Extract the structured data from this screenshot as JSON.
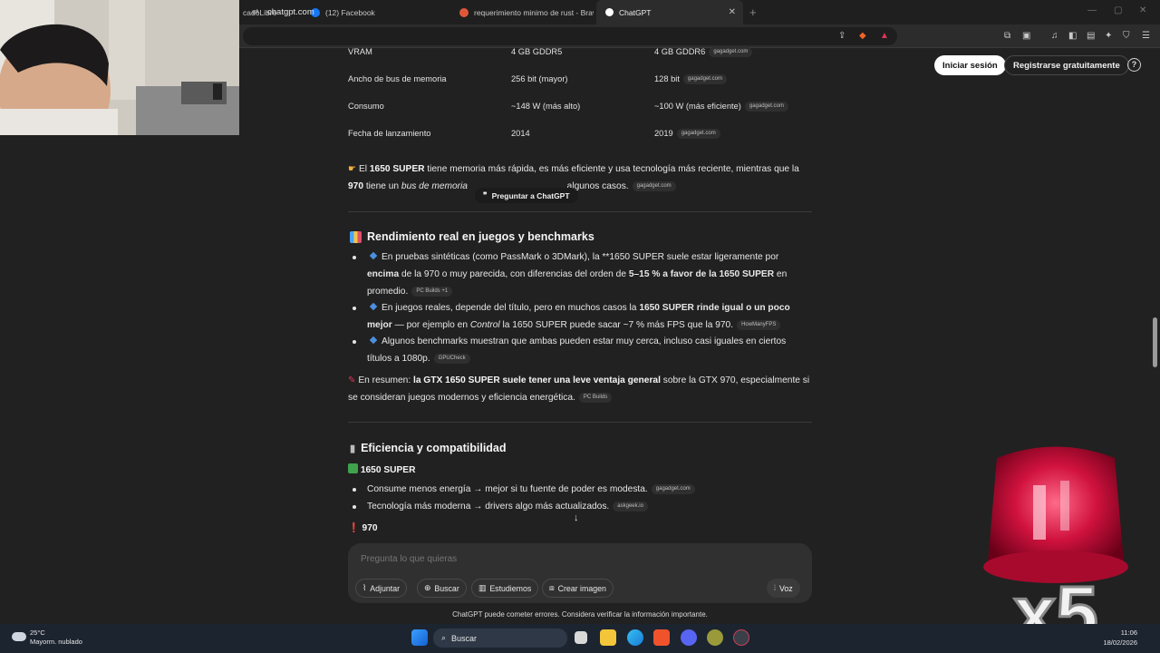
{
  "browser": {
    "tabs": [
      {
        "label": "cadoLibre",
        "active": false
      },
      {
        "label": "(12) Facebook",
        "active": false
      },
      {
        "label": "requerimiento minimo de rust - Brave",
        "active": false
      },
      {
        "label": "ChatGPT",
        "active": true
      }
    ],
    "url": "chatgpt.com"
  },
  "header": {
    "login_label": "Iniciar sesión",
    "register_label": "Registrarse gratuitamente",
    "help_label": "?"
  },
  "table": {
    "rows": [
      {
        "spec": "VRAM",
        "gtx970": "4 GB GDDR5",
        "gtx1650": "4 GB GDDR6",
        "source": "gagadget.com"
      },
      {
        "spec": "Ancho de bus de memoria",
        "gtx970": "256 bit (mayor)",
        "gtx1650": "128 bit",
        "source": "gagadget.com"
      },
      {
        "spec": "Consumo",
        "gtx970": "~148 W (más alto)",
        "gtx1650": "~100 W (más eficiente)",
        "source": "gagadget.com"
      },
      {
        "spec": "Fecha de lanzamiento",
        "gtx970": "2014",
        "gtx1650": "2019",
        "source": "gagadget.com"
      }
    ]
  },
  "summary": {
    "p1_prefix": "El ",
    "p1_bold": "1650 SUPER",
    "p1_rest": " tiene memoria más rápida, es más eficiente y usa tecnología más reciente, mientras que la",
    "p2_bold": "970",
    "p2_mid": " tiene un ",
    "p2_italic": "bus de memoria",
    "p2_end": "algunos casos.",
    "source": "gagadget.com",
    "ask_label": "Preguntar a ChatGPT"
  },
  "section_perf": {
    "title": "Rendimiento real en juegos y benchmarks",
    "items": [
      {
        "line1": "En pruebas sintéticas (como PassMark o 3DMark), la **1650 SUPER suele estar ligeramente por",
        "line2_bold": "encima",
        "line2_mid": " de la 970 o muy parecida, con diferencias del orden de ",
        "line2_bold2": "5–15 % a favor de la 1650 SUPER",
        "line2_end": " en",
        "line3": "promedio.",
        "source": "PC Builds +1"
      },
      {
        "line1_pre": "En juegos reales, depende del título, pero en muchos casos la ",
        "line1_bold": "1650 SUPER rinde igual o un poco",
        "line2_bold": "mejor",
        "line2_mid": " — por ejemplo en ",
        "line2_italic": "Control",
        "line2_end": " la 1650 SUPER puede sacar ~7 % más FPS que la 970.",
        "source": "HowManyFPS"
      },
      {
        "line1": "Algunos benchmarks muestran que ambas pueden estar muy cerca, incluso casi iguales en ciertos",
        "line2": "títulos a 1080p.",
        "source": "GPUCheck"
      }
    ],
    "conclusion_pre": "En resumen: ",
    "conclusion_bold": "la GTX 1650 SUPER suele tener una leve ventaja general",
    "conclusion_rest": " sobre la GTX 970, especialmente si",
    "conclusion_line2": "se consideran juegos modernos y eficiencia energética.",
    "conclusion_source": "PC Builds"
  },
  "section_eff": {
    "title": "Eficiencia y compatibilidad",
    "card1_title": "1650 SUPER",
    "items": [
      {
        "text": "Consume menos energía → mejor si tu fuente de poder es modesta.",
        "source": "gagadget.com"
      },
      {
        "text": "Tecnología más moderna → drivers algo más actualizados.",
        "source": "askgeek.io"
      }
    ],
    "card2_title": "970"
  },
  "composer": {
    "placeholder": "Pregunta lo que quieras",
    "buttons": {
      "attach": "Adjuntar",
      "search": "Buscar",
      "study": "Estudiemos",
      "image": "Crear imagen"
    },
    "voice_label": "Voz"
  },
  "disclaimer": "ChatGPT puede cometer errores. Considera verificar la información importante.",
  "overlay": {
    "multiplier": "x5"
  },
  "taskbar": {
    "temperature": "25°C",
    "weather": "Mayorm. nublado",
    "search_label": "Buscar",
    "time": "11:06",
    "date": "18/02/2026"
  },
  "colors": {
    "background": "#212121",
    "accent_diamond": "#4b8fe0",
    "siren": "#c8103c"
  }
}
